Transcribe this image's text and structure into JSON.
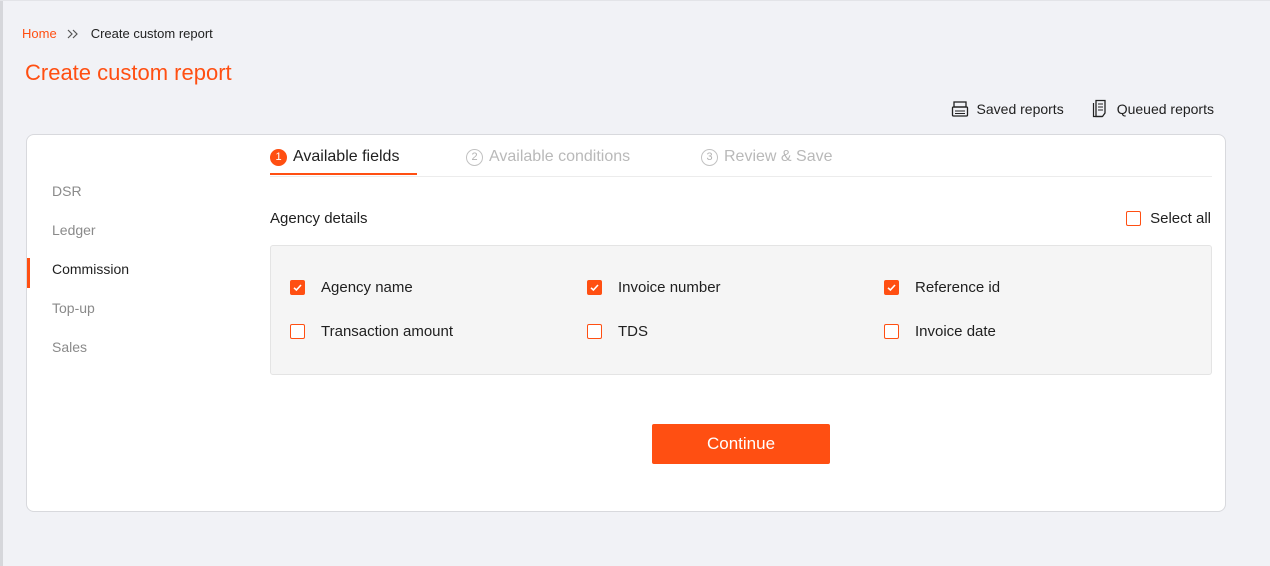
{
  "breadcrumb": {
    "home": "Home",
    "current": "Create custom report"
  },
  "page": {
    "title": "Create custom report"
  },
  "header_actions": {
    "saved_reports": "Saved reports",
    "queued_reports": "Queued reports"
  },
  "sidebar": {
    "items": [
      {
        "label": "DSR",
        "active": false
      },
      {
        "label": "Ledger",
        "active": false
      },
      {
        "label": "Commission",
        "active": true
      },
      {
        "label": "Top-up",
        "active": false
      },
      {
        "label": "Sales",
        "active": false
      }
    ]
  },
  "steps": [
    {
      "number": "1",
      "label": "Available fields",
      "active": true
    },
    {
      "number": "2",
      "label": "Available conditions",
      "active": false
    },
    {
      "number": "3",
      "label": "Review & Save",
      "active": false
    }
  ],
  "section": {
    "title": "Agency details",
    "select_all_label": "Select all",
    "select_all_checked": false,
    "fields": [
      {
        "label": "Agency name",
        "checked": true
      },
      {
        "label": "Invoice number",
        "checked": true
      },
      {
        "label": "Reference id",
        "checked": true
      },
      {
        "label": "Transaction amount",
        "checked": false
      },
      {
        "label": "TDS",
        "checked": false
      },
      {
        "label": "Invoice date",
        "checked": false
      }
    ]
  },
  "continue_label": "Continue",
  "colors": {
    "accent": "#ff4f12",
    "background": "#f1f2f6",
    "card": "#ffffff",
    "muted_text": "#8a8a8a"
  },
  "icons": {
    "breadcrumb_separator": "double-chevron-right-icon",
    "saved_reports": "printer-tray-icon",
    "queued_reports": "document-list-icon",
    "checkbox_checked": "checkmark-icon"
  }
}
